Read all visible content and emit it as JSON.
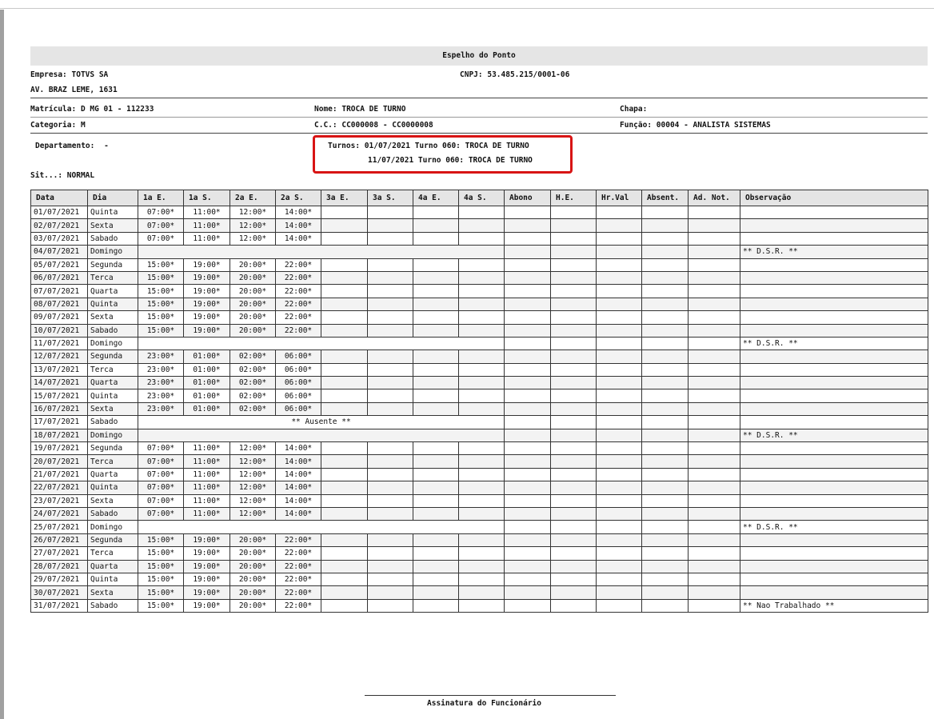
{
  "report": {
    "title": "Espelho do Ponto",
    "empresa_label": "Empresa:",
    "empresa": "TOTVS SA",
    "cnpj_label": "CNPJ:",
    "cnpj": "53.485.215/0001-06",
    "endereco": "AV. BRAZ LEME, 1631",
    "matricula_label": "Matrícula:",
    "matricula": "D MG 01 - 112233",
    "nome_label": "Nome:",
    "nome": "TROCA DE TURNO",
    "chapa_label": "Chapa:",
    "chapa": "",
    "categoria_label": "Categoria:",
    "categoria": "M",
    "cc_label": "C.C.:",
    "cc": "CC000008 - CC0000008",
    "funcao_label": "Função:",
    "funcao": "00004 - ANALISTA SISTEMAS",
    "departamento_label": "Departamento:",
    "departamento": "-",
    "turnos_label": "Turnos:",
    "turnos": [
      "01/07/2021 Turno 060: TROCA DE TURNO",
      "11/07/2021 Turno 060: TROCA DE TURNO"
    ],
    "sit_label": "Sit...:",
    "sit": "NORMAL",
    "assinatura": "Assinatura do Funcionário",
    "highlight_color": "#d81414"
  },
  "table": {
    "headers": [
      "Data",
      "Dia",
      "1a E.",
      "1a S.",
      "2a E.",
      "2a S.",
      "3a E.",
      "3a S.",
      "4a E.",
      "4a S.",
      "Abono",
      "H.E.",
      "Hr.Val",
      "Absent.",
      "Ad. Not.",
      "Observação"
    ],
    "rows": [
      {
        "data": "01/07/2021",
        "dia": "Quinta",
        "marks": [
          "07:00*",
          "11:00*",
          "12:00*",
          "14:00*"
        ],
        "obs": ""
      },
      {
        "data": "02/07/2021",
        "dia": "Sexta",
        "marks": [
          "07:00*",
          "11:00*",
          "12:00*",
          "14:00*"
        ],
        "obs": ""
      },
      {
        "data": "03/07/2021",
        "dia": "Sabado",
        "marks": [
          "07:00*",
          "11:00*",
          "12:00*",
          "14:00*"
        ],
        "obs": ""
      },
      {
        "data": "04/07/2021",
        "dia": "Domingo",
        "marks": null,
        "obs": "** D.S.R. **"
      },
      {
        "data": "05/07/2021",
        "dia": "Segunda",
        "marks": [
          "15:00*",
          "19:00*",
          "20:00*",
          "22:00*"
        ],
        "obs": ""
      },
      {
        "data": "06/07/2021",
        "dia": "Terca",
        "marks": [
          "15:00*",
          "19:00*",
          "20:00*",
          "22:00*"
        ],
        "obs": ""
      },
      {
        "data": "07/07/2021",
        "dia": "Quarta",
        "marks": [
          "15:00*",
          "19:00*",
          "20:00*",
          "22:00*"
        ],
        "obs": ""
      },
      {
        "data": "08/07/2021",
        "dia": "Quinta",
        "marks": [
          "15:00*",
          "19:00*",
          "20:00*",
          "22:00*"
        ],
        "obs": ""
      },
      {
        "data": "09/07/2021",
        "dia": "Sexta",
        "marks": [
          "15:00*",
          "19:00*",
          "20:00*",
          "22:00*"
        ],
        "obs": ""
      },
      {
        "data": "10/07/2021",
        "dia": "Sabado",
        "marks": [
          "15:00*",
          "19:00*",
          "20:00*",
          "22:00*"
        ],
        "obs": ""
      },
      {
        "data": "11/07/2021",
        "dia": "Domingo",
        "marks": null,
        "obs": "** D.S.R. **"
      },
      {
        "data": "12/07/2021",
        "dia": "Segunda",
        "marks": [
          "23:00*",
          "01:00*",
          "02:00*",
          "06:00*"
        ],
        "obs": ""
      },
      {
        "data": "13/07/2021",
        "dia": "Terca",
        "marks": [
          "23:00*",
          "01:00*",
          "02:00*",
          "06:00*"
        ],
        "obs": ""
      },
      {
        "data": "14/07/2021",
        "dia": "Quarta",
        "marks": [
          "23:00*",
          "01:00*",
          "02:00*",
          "06:00*"
        ],
        "obs": ""
      },
      {
        "data": "15/07/2021",
        "dia": "Quinta",
        "marks": [
          "23:00*",
          "01:00*",
          "02:00*",
          "06:00*"
        ],
        "obs": ""
      },
      {
        "data": "16/07/2021",
        "dia": "Sexta",
        "marks": [
          "23:00*",
          "01:00*",
          "02:00*",
          "06:00*"
        ],
        "obs": ""
      },
      {
        "data": "17/07/2021",
        "dia": "Sabado",
        "marks": null,
        "span_text": "** Ausente **",
        "obs": ""
      },
      {
        "data": "18/07/2021",
        "dia": "Domingo",
        "marks": null,
        "obs": "** D.S.R. **"
      },
      {
        "data": "19/07/2021",
        "dia": "Segunda",
        "marks": [
          "07:00*",
          "11:00*",
          "12:00*",
          "14:00*"
        ],
        "obs": ""
      },
      {
        "data": "20/07/2021",
        "dia": "Terca",
        "marks": [
          "07:00*",
          "11:00*",
          "12:00*",
          "14:00*"
        ],
        "obs": ""
      },
      {
        "data": "21/07/2021",
        "dia": "Quarta",
        "marks": [
          "07:00*",
          "11:00*",
          "12:00*",
          "14:00*"
        ],
        "obs": ""
      },
      {
        "data": "22/07/2021",
        "dia": "Quinta",
        "marks": [
          "07:00*",
          "11:00*",
          "12:00*",
          "14:00*"
        ],
        "obs": ""
      },
      {
        "data": "23/07/2021",
        "dia": "Sexta",
        "marks": [
          "07:00*",
          "11:00*",
          "12:00*",
          "14:00*"
        ],
        "obs": ""
      },
      {
        "data": "24/07/2021",
        "dia": "Sabado",
        "marks": [
          "07:00*",
          "11:00*",
          "12:00*",
          "14:00*"
        ],
        "obs": ""
      },
      {
        "data": "25/07/2021",
        "dia": "Domingo",
        "marks": null,
        "obs": "** D.S.R. **"
      },
      {
        "data": "26/07/2021",
        "dia": "Segunda",
        "marks": [
          "15:00*",
          "19:00*",
          "20:00*",
          "22:00*"
        ],
        "obs": ""
      },
      {
        "data": "27/07/2021",
        "dia": "Terca",
        "marks": [
          "15:00*",
          "19:00*",
          "20:00*",
          "22:00*"
        ],
        "obs": ""
      },
      {
        "data": "28/07/2021",
        "dia": "Quarta",
        "marks": [
          "15:00*",
          "19:00*",
          "20:00*",
          "22:00*"
        ],
        "obs": ""
      },
      {
        "data": "29/07/2021",
        "dia": "Quinta",
        "marks": [
          "15:00*",
          "19:00*",
          "20:00*",
          "22:00*"
        ],
        "obs": ""
      },
      {
        "data": "30/07/2021",
        "dia": "Sexta",
        "marks": [
          "15:00*",
          "19:00*",
          "20:00*",
          "22:00*"
        ],
        "obs": ""
      },
      {
        "data": "31/07/2021",
        "dia": "Sabado",
        "marks": [
          "15:00*",
          "19:00*",
          "20:00*",
          "22:00*"
        ],
        "obs": "** Nao Trabalhado **"
      }
    ]
  }
}
